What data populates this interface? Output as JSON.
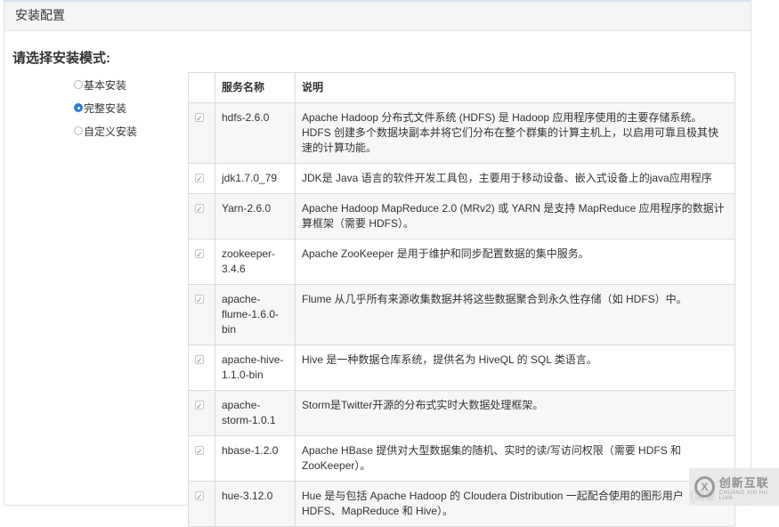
{
  "panel": {
    "title": "安装配置"
  },
  "prompt": "请选择安装模式:",
  "modes": [
    {
      "label": "基本安装",
      "checked": false
    },
    {
      "label": "完整安装",
      "checked": true
    },
    {
      "label": "自定义安装",
      "checked": false
    }
  ],
  "table": {
    "headers": {
      "check": "",
      "name": "服务名称",
      "desc": "说明"
    },
    "rows": [
      {
        "checked": true,
        "name": "hdfs-2.6.0",
        "desc": "Apache Hadoop 分布式文件系统 (HDFS) 是 Hadoop 应用程序使用的主要存储系统。HDFS 创建多个数据块副本并将它们分布在整个群集的计算主机上，以启用可靠且极其快速的计算功能。"
      },
      {
        "checked": true,
        "name": "jdk1.7.0_79",
        "desc": "JDK是 Java 语言的软件开发工具包，主要用于移动设备、嵌入式设备上的java应用程序"
      },
      {
        "checked": true,
        "name": "Yarn-2.6.0",
        "desc": "Apache Hadoop MapReduce 2.0 (MRv2) 或 YARN 是支持 MapReduce 应用程序的数据计算框架（需要 HDFS）。"
      },
      {
        "checked": true,
        "name": "zookeeper-3.4.6",
        "desc": "Apache ZooKeeper 是用于维护和同步配置数据的集中服务。"
      },
      {
        "checked": true,
        "name": "apache-flume-1.6.0-bin",
        "desc": "Flume 从几乎所有来源收集数据并将这些数据聚合到永久性存储（如 HDFS）中。"
      },
      {
        "checked": true,
        "name": "apache-hive-1.1.0-bin",
        "desc": "Hive 是一种数据仓库系统，提供名为 HiveQL 的 SQL 类语言。"
      },
      {
        "checked": true,
        "name": "apache-storm-1.0.1",
        "desc": "Storm是Twitter开源的分布式实时大数据处理框架。"
      },
      {
        "checked": true,
        "name": "hbase-1.2.0",
        "desc": "Apache HBase 提供对大型数据集的随机、实时的读/写访问权限（需要 HDFS 和 ZooKeeper）。"
      },
      {
        "checked": true,
        "name": "hue-3.12.0",
        "desc": "Hue 是与包括 Apache Hadoop 的 Cloudera Distribution 一起配合使用的图形用户（需要 HDFS、MapReduce 和 Hive）。"
      }
    ]
  },
  "watermark": {
    "main": "创新互联",
    "sub": "CHUANG XIN HU LIAN"
  },
  "icons": {
    "check": "✓",
    "logo": "X"
  },
  "colors": {
    "accent": "#2a7ed3"
  }
}
